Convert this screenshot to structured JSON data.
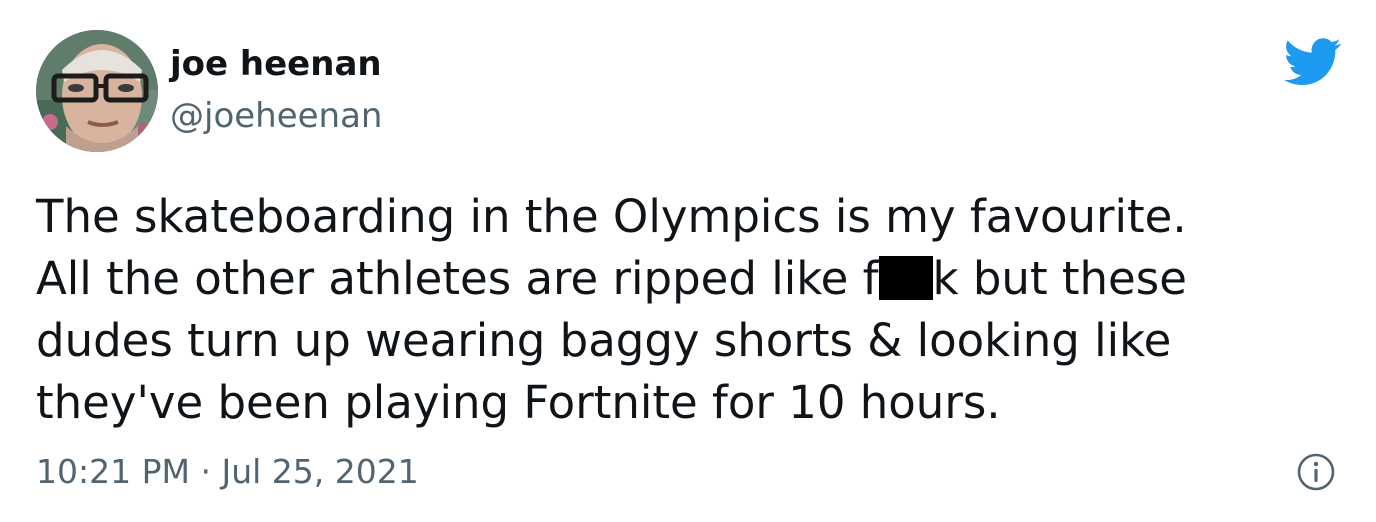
{
  "author": {
    "name": "joe heenan",
    "handle": "@joeheenan"
  },
  "icons": {
    "brand": "twitter-bird-icon",
    "info": "info-icon",
    "avatar": "avatar"
  },
  "colors": {
    "brand": "#1d9bf0",
    "text": "#0f1419",
    "secondary": "#536471"
  },
  "tweet": {
    "line1": "The skateboarding in the Olympics is my favourite.",
    "line2_before": "All the other athletes are ripped like f",
    "line2_after": "k but these",
    "line3": "dudes turn up wearing baggy shorts & looking like",
    "line4": "they've been playing Fortnite for 10 hours."
  },
  "meta": {
    "time": "10:21 PM",
    "separator": "·",
    "date": "Jul 25, 2021"
  }
}
